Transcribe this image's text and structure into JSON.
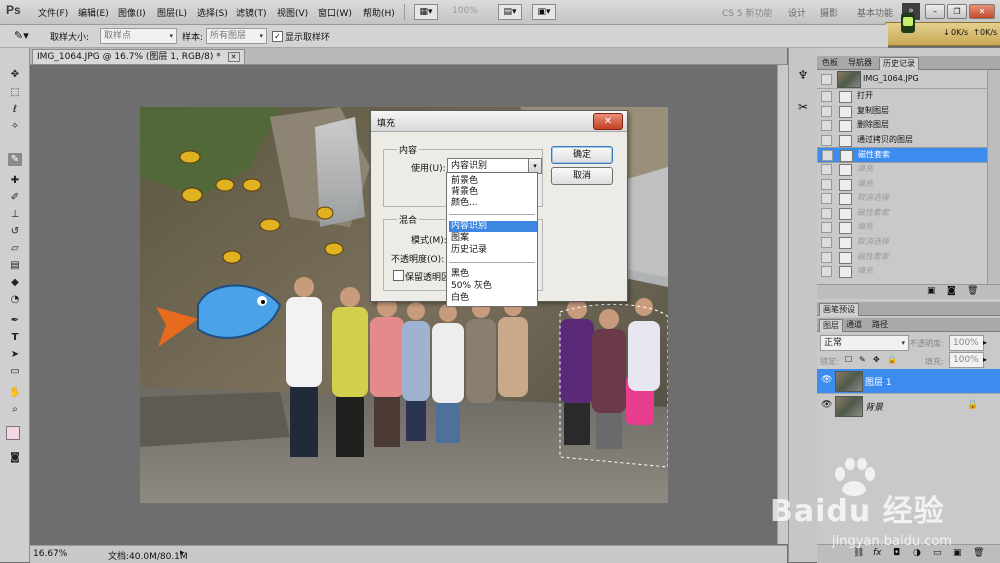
{
  "menubar": {
    "logo": "Ps",
    "items": [
      "文件(F)",
      "编辑(E)",
      "图像(I)",
      "图层(L)",
      "选择(S)",
      "滤镜(T)",
      "视图(V)",
      "窗口(W)",
      "帮助(H)"
    ],
    "zoom": "100%",
    "workspaces": [
      "CS 5 新功能",
      "设计",
      "摄影",
      "基本功能"
    ],
    "speed_down": "0K/s",
    "speed_up": "0K/s"
  },
  "optbar": {
    "sample_size_label": "取样大小:",
    "sample_size_value": "取样点",
    "sample_label": "样本:",
    "sample_value": "所有图层",
    "show_ring_label": "显示取样环",
    "show_ring_checked": true
  },
  "document": {
    "tab_title": "IMG_1064.JPG @ 16.7% (图层 1, RGB/8) *",
    "zoom_readout": "16.67%",
    "doc_size": "文档:40.0M/80.1M"
  },
  "panels": {
    "top_tabs": [
      "色板",
      "导航器",
      "历史记录"
    ],
    "history_snapshot": "IMG_1064.JPG",
    "history": [
      {
        "label": "打开",
        "state": "normal"
      },
      {
        "label": "复制图层",
        "state": "normal"
      },
      {
        "label": "删除图层",
        "state": "normal"
      },
      {
        "label": "通过拷贝的图层",
        "state": "normal"
      },
      {
        "label": "磁性套索",
        "state": "selected"
      },
      {
        "label": "填充",
        "state": "dim"
      },
      {
        "label": "填充",
        "state": "dim"
      },
      {
        "label": "取消选择",
        "state": "dim"
      },
      {
        "label": "磁性套索",
        "state": "dim"
      },
      {
        "label": "填充",
        "state": "dim"
      },
      {
        "label": "取消选择",
        "state": "dim"
      },
      {
        "label": "磁性套索",
        "state": "dim"
      },
      {
        "label": "填充",
        "state": "dim"
      }
    ],
    "brush_tab": "画笔预设",
    "layer_tabs": [
      "图层",
      "通道",
      "路径"
    ],
    "blend_mode": "正常",
    "opacity_label": "不透明度:",
    "opacity_value": "100%",
    "lock_label": "锁定:",
    "fill_label": "填充:",
    "fill_value": "100%",
    "layers": [
      {
        "name": "图层 1",
        "selected": true
      },
      {
        "name": "背景",
        "selected": false
      }
    ]
  },
  "dialog": {
    "title": "填充",
    "content_group": "内容",
    "use_label": "使用(U):",
    "use_value": "内容识别",
    "ok_label": "确定",
    "cancel_label": "取消",
    "blend_group": "混合",
    "mode_label": "模式(M):",
    "opacity_label": "不透明度(O):",
    "preserve_label": "保留透明区",
    "dropdown_items": [
      "前景色",
      "背景色",
      "颜色...",
      "内容识别",
      "图案",
      "历史记录",
      "黑色",
      "50% 灰色",
      "白色"
    ],
    "dropdown_selected": "内容识别"
  },
  "watermark": {
    "brand": "Baidu 经验",
    "url": "jingyan.baidu.com"
  },
  "colors": {
    "selection_blue": "#3c8cf0",
    "foreground_swatch": "#f4d6e6"
  }
}
